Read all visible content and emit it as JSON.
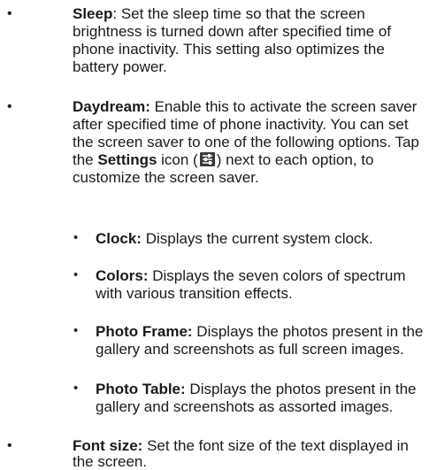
{
  "items": [
    {
      "bullet": "•",
      "title": "Sleep",
      "sep": ":",
      "text": " Set the sleep time so that the screen brightness is turned down after specified time of phone inactivity. This setting also optimizes the battery power."
    },
    {
      "bullet": "•",
      "title": "Daydream:",
      "text_before": " Enable this to activate the screen saver after specified time of phone inactivity. You can set the screen saver to one of the following options. Tap the ",
      "settings_label": "Settings",
      "text_icon_open": " icon (",
      "icon": "settings-icon",
      "text_icon_close": ")",
      "text_after": " next to each option, to customize the screen saver.",
      "options": [
        {
          "bullet": "•",
          "title": "Clock:",
          "text": " Displays the current system clock."
        },
        {
          "bullet": "•",
          "title": "Colors:",
          "text": " Displays the seven colors of spectrum with various transition effects."
        },
        {
          "bullet": "•",
          "title": "Photo Frame:",
          "text": " Displays the photos present in the gallery and screenshots as full screen images."
        },
        {
          "bullet": "•",
          "title": "Photo Table:",
          "text": " Displays the photos present in the gallery and screenshots as assorted images."
        }
      ]
    },
    {
      "bullet": "•",
      "title": "Font size:",
      "text": " Set the font size of the text displayed in the screen."
    }
  ],
  "colors": {
    "text": "#1a1a1a",
    "icon_bg": "#3a3a3a",
    "icon_fg": "#ffffff"
  }
}
